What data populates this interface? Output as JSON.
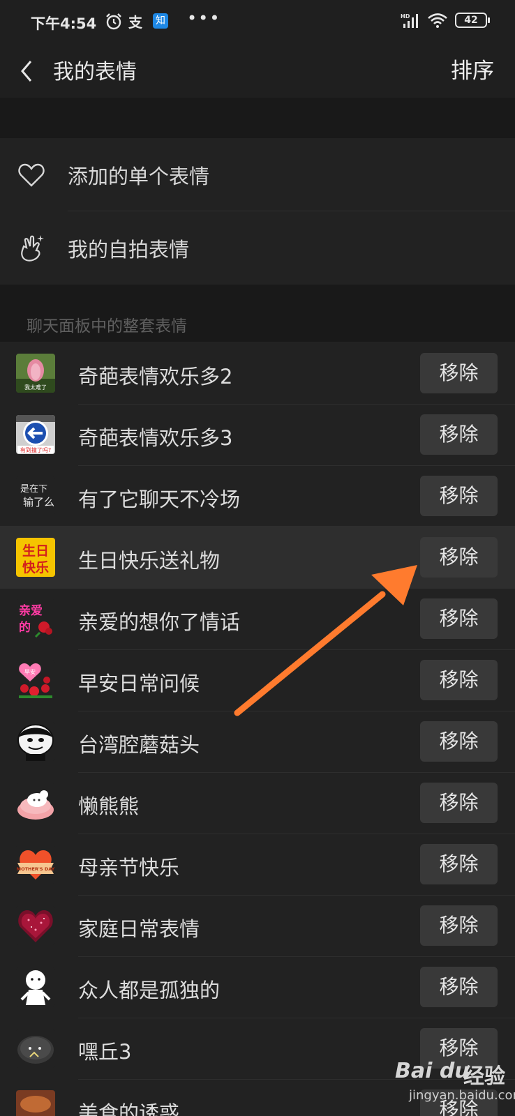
{
  "status_bar": {
    "time": "下午4:54",
    "app_icon_1": "支",
    "app_icon_2": "知",
    "more": "•••",
    "battery": "42"
  },
  "nav": {
    "title": "我的表情",
    "sort_label": "排序"
  },
  "single_stickers": [
    {
      "label": "添加的单个表情",
      "icon": "heart-icon"
    },
    {
      "label": "我的自拍表情",
      "icon": "selfie-hand-icon"
    }
  ],
  "section_header": "聊天面板中的整套表情",
  "packs": [
    {
      "name": "奇葩表情欢乐多2",
      "remove": "移除"
    },
    {
      "name": "奇葩表情欢乐多3",
      "remove": "移除"
    },
    {
      "name": "有了它聊天不冷场",
      "remove": "移除"
    },
    {
      "name": "生日快乐送礼物",
      "remove": "移除"
    },
    {
      "name": "亲爱的想你了情话",
      "remove": "移除"
    },
    {
      "name": "早安日常问候",
      "remove": "移除"
    },
    {
      "name": "台湾腔蘑菇头",
      "remove": "移除"
    },
    {
      "name": "懒熊熊",
      "remove": "移除"
    },
    {
      "name": "母亲节快乐",
      "remove": "移除"
    },
    {
      "name": "家庭日常表情",
      "remove": "移除"
    },
    {
      "name": "众人都是孤独的",
      "remove": "移除"
    },
    {
      "name": "嘿丘3",
      "remove": "移除"
    },
    {
      "name": "美食的诱惑",
      "remove": "移除"
    }
  ],
  "thumb_text": {
    "p1": "我太难了",
    "p2": "有到撞了吗?",
    "p3a": "是在下",
    "p3b": "输了么",
    "p4a": "生日",
    "p4b": "快乐",
    "p5a": "亲爱",
    "p5b": "的",
    "p6": "早安",
    "p9": "MOTHER'S DAY"
  },
  "watermark": {
    "logo": "Bai du",
    "logo2": "经验",
    "url": "jingyan.baidu.com"
  },
  "colors": {
    "background": "#191919",
    "row": "#222222",
    "button": "#393939",
    "highlight_row": "#2e2e2e",
    "arrow": "#ff7b2e"
  }
}
